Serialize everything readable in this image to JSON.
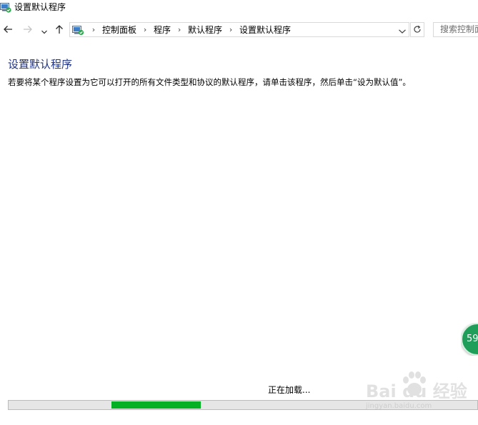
{
  "window": {
    "title": "设置默认程序",
    "title_icon": "control-panel-icon"
  },
  "nav": {
    "back_icon": "arrow-left-icon",
    "forward_icon": "arrow-right-icon",
    "recent_icon": "chevron-down-icon",
    "up_icon": "arrow-up-icon"
  },
  "address": {
    "icon": "control-panel-icon",
    "breadcrumbs": [
      "控制面板",
      "程序",
      "默认程序",
      "设置默认程序"
    ],
    "dropdown_icon": "chevron-down-icon",
    "refresh_icon": "refresh-icon"
  },
  "search": {
    "placeholder": "搜索控制面板"
  },
  "main": {
    "title": "设置默认程序",
    "description": "若要将某个程序设置为它可以打开的所有文件类型和协议的默认程序，请单击该程序，然后单击“设为默认值”。"
  },
  "loading": {
    "text": "正在加载...",
    "progress_start": 0.22,
    "progress_end": 0.41,
    "fill_color": "#06b025"
  },
  "badge": {
    "text": "59"
  },
  "watermark": {
    "brand": "Bai du 经验",
    "url": "jingyan.baidu.com"
  },
  "colors": {
    "title_blue": "#1e3287",
    "progress_green": "#06b025"
  }
}
